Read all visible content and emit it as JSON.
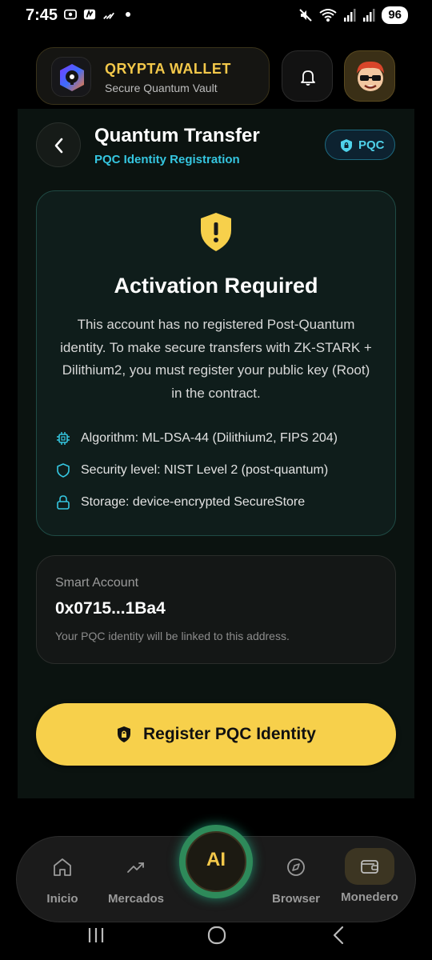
{
  "status_bar": {
    "time": "7:45",
    "battery": "96",
    "icons": [
      "screen-record-icon",
      "app-icon",
      "signal-strength-icon",
      "dot-icon",
      "mute-icon",
      "wifi-icon",
      "signal-icon",
      "signal-icon-2"
    ]
  },
  "header": {
    "app_name": "QRYPTA WALLET",
    "app_subtitle": "Secure Quantum Vault",
    "icons": [
      "logo-icon",
      "bell-icon",
      "avatar"
    ]
  },
  "page": {
    "title": "Quantum Transfer",
    "subtitle": "PQC Identity Registration",
    "badge": "PQC"
  },
  "activation": {
    "title": "Activation Required",
    "description": "This account has no registered Post-Quantum identity. To make secure transfers with ZK-STARK + Dilithium2, you must register your public key (Root) in the contract.",
    "features": [
      {
        "icon": "chip-icon",
        "text": "Algorithm: ML-DSA-44 (Dilithium2, FIPS 204)"
      },
      {
        "icon": "shield-icon",
        "text": "Security level: NIST Level 2 (post-quantum)"
      },
      {
        "icon": "lock-icon",
        "text": "Storage: device-encrypted SecureStore"
      }
    ]
  },
  "smart_account": {
    "label": "Smart Account",
    "address": "0x0715...1Ba4",
    "note": "Your PQC identity will be linked to this address."
  },
  "register_button": {
    "label": "Register PQC Identity"
  },
  "bottom_nav": {
    "items": [
      {
        "label": "Inicio",
        "icon": "home-icon"
      },
      {
        "label": "Mercados",
        "icon": "trending-up-icon"
      },
      {
        "label": "AI",
        "icon": "ai-button"
      },
      {
        "label": "Browser",
        "icon": "compass-icon"
      },
      {
        "label": "Monedero",
        "icon": "wallet-icon"
      }
    ],
    "active": "Monedero"
  },
  "colors": {
    "accent_yellow": "#f7d04b",
    "accent_cyan": "#35c6e0",
    "card_border_teal": "#1f4a44",
    "background": "#000000"
  }
}
